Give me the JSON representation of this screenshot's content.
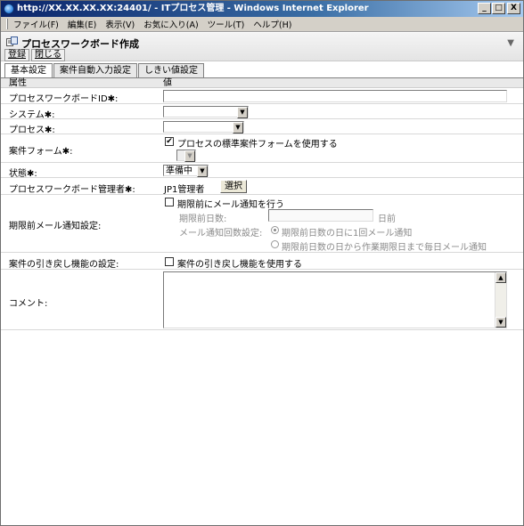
{
  "window": {
    "title": "http://XX.XX.XX.XX:24401/ - ITプロセス管理 - Windows Internet Explorer",
    "min_label": "_",
    "max_label": "□",
    "close_label": "X"
  },
  "menu": {
    "items": [
      "ファイル(F)",
      "編集(E)",
      "表示(V)",
      "お気に入り(A)",
      "ツール(T)",
      "ヘルプ(H)"
    ]
  },
  "page": {
    "title": "プロセスワークボード作成",
    "collapse_icon": "▼",
    "actions": {
      "register": "登録",
      "close": "閉じる"
    }
  },
  "tabs": [
    "基本設定",
    "案件自動入力設定",
    "しきい値設定"
  ],
  "table": {
    "header": {
      "attr": "属性",
      "value": "値"
    },
    "rows": {
      "board_id": {
        "label": "プロセスワークボードID✱:",
        "value": ""
      },
      "system": {
        "label": "システム✱:",
        "value": ""
      },
      "process": {
        "label": "プロセス✱:",
        "value": ""
      },
      "form": {
        "label": "案件フォーム✱:",
        "checkbox_label": "プロセスの標準案件フォームを使用する",
        "checked": true,
        "select_value": ""
      },
      "status": {
        "label": "状態✱:",
        "value": "準備中"
      },
      "manager": {
        "label": "プロセスワークボード管理者✱:",
        "value": "JP1管理者",
        "select_button": "選択"
      },
      "mail": {
        "label": "期限前メール通知設定:",
        "checkbox_label": "期限前にメール通知を行う",
        "days_label": "期限前日数:",
        "days_value": "",
        "days_unit": "日前",
        "freq_label": "メール通知回数設定:",
        "radio1": "期限前日数の日に1回メール通知",
        "radio2": "期限前日数の日から作業期限日まで毎日メール通知"
      },
      "pullback": {
        "label": "案件の引き戻し機能の設定:",
        "checkbox_label": "案件の引き戻し機能を使用する",
        "checked": false
      },
      "comment": {
        "label": "コメント:",
        "value": ""
      }
    }
  },
  "glyphs": {
    "arrow_down": "▼",
    "arrow_up": "▲",
    "check": "✔"
  }
}
